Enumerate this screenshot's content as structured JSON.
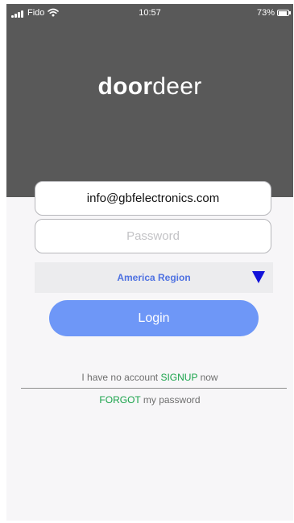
{
  "status_bar": {
    "carrier": "Fido",
    "time": "10:57",
    "battery": "73%",
    "signal_icon": "cellular-signal-icon",
    "wifi_icon": "wifi-icon",
    "battery_icon": "battery-icon"
  },
  "brand": {
    "logo_bold": "door",
    "logo_light": "deer"
  },
  "login_form": {
    "email_value": "info@gbfelectronics.com",
    "password_placeholder": "Password",
    "region_value": "America Region",
    "region_arrow_icon": "dropdown-triangle-icon",
    "login_label": "Login"
  },
  "links": {
    "signup_prefix": "I have no account ",
    "signup_link": "SIGNUP",
    "signup_suffix": " now",
    "forgot_link": "FORGOT",
    "forgot_suffix": " my password"
  },
  "colors": {
    "header_bg": "#595959",
    "accent_blue": "#6e97f7",
    "region_text": "#4f72e1",
    "arrow_blue": "#1212d9",
    "link_green": "#19a34a"
  }
}
